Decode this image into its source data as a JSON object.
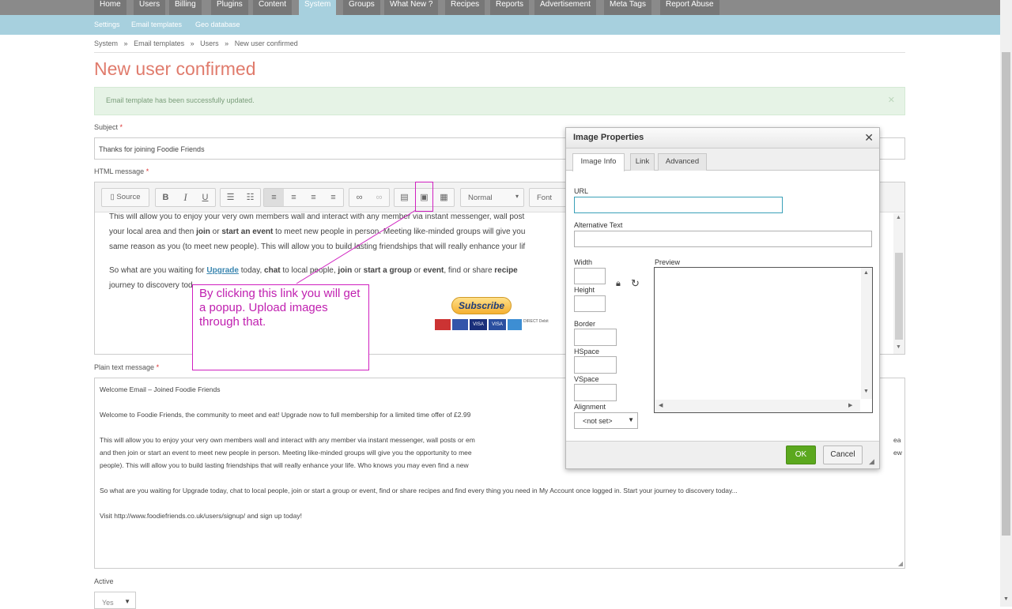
{
  "nav": {
    "items": [
      "Home",
      "Users",
      "Billing",
      "Plugins",
      "Content",
      "System",
      "Groups",
      "What New ?",
      "Recipes",
      "Reports",
      "Advertisement",
      "Meta Tags",
      "Report Abuse"
    ],
    "active": "System"
  },
  "subnav": {
    "items": [
      "Settings",
      "Email templates",
      "Geo database"
    ]
  },
  "breadcrumb": {
    "items": [
      "System",
      "Email templates",
      "Users",
      "New user confirmed"
    ],
    "separator": "»"
  },
  "page": {
    "title": "New user confirmed",
    "alert": "Email template has been successfully updated.",
    "subject_label": "Subject",
    "subject_value": "Thanks for joining Foodie Friends",
    "html_label": "HTML message",
    "plain_label": "Plain text message",
    "active_label": "Active",
    "active_value": "Yes",
    "required_mark": "*"
  },
  "editor": {
    "toolbar": {
      "source": "Source",
      "format": "Normal",
      "font": "Font"
    },
    "lines": {
      "l1a": "This will allow you to enjoy your very own members wall and interact with any member via instant messenger, wall post",
      "l2a": "your local area and then ",
      "l2b": "join",
      "l2c": " or ",
      "l2d": "start an event",
      "l2e": " to meet new people in person. Meeting like-minded groups will give you",
      "l3a": "same reason as you (to meet new people). This will allow you to build lasting friendships that will really enhance your lif",
      "l4a": "So what are you waiting for ",
      "l4link": "Upgrade",
      "l4b": " today, ",
      "l4c": "chat",
      "l4d": " to local people, ",
      "l4e": "join",
      "l4f": " or ",
      "l4g": "start a group",
      "l4h": " or ",
      "l4i": "event",
      "l4j": ", find or share ",
      "l4k": "recipe",
      "l5a": "journey to discovery tod"
    },
    "subscribe_label": "Subscribe",
    "card_labels": [
      "VISA",
      "VISA",
      "DIRECT Debit"
    ]
  },
  "plain_text": {
    "lines": [
      "Welcome Email – Joined Foodie Friends",
      "Welcome to Foodie Friends, the community to meet and eat! Upgrade now to full membership for a limited time offer of £2.99",
      "This will allow you to enjoy your very own members wall and interact with any member via instant messenger, wall posts or em",
      "and then join or start an event to meet new people in person. Meeting like-minded groups will give you the opportunity to mee",
      "people). This will allow you to build lasting friendships that will really enhance your life. Who knows you may even find a new",
      "So what are you waiting for Upgrade today, chat to local people, join or start a group or event, find or share recipes and find every thing you need in My Account once logged in. Start your journey to discovery today...",
      "Visit http://www.foodiefriends.co.uk/users/signup/ and sign up today!"
    ],
    "right_overflow": [
      "ea",
      "ew"
    ]
  },
  "dialog": {
    "title": "Image Properties",
    "tabs": [
      "Image Info",
      "Link",
      "Advanced"
    ],
    "active_tab": "Image Info",
    "url_label": "URL",
    "url_value": "",
    "alt_label": "Alternative Text",
    "alt_value": "",
    "width_label": "Width",
    "height_label": "Height",
    "border_label": "Border",
    "hspace_label": "HSpace",
    "vspace_label": "VSpace",
    "alignment_label": "Alignment",
    "alignment_value": "<not set>",
    "preview_label": "Preview",
    "ok_label": "OK",
    "cancel_label": "Cancel"
  },
  "annotation": {
    "text": "By clicking this link you will get a popup. Upload images through that.",
    "color": "#d020c0"
  }
}
